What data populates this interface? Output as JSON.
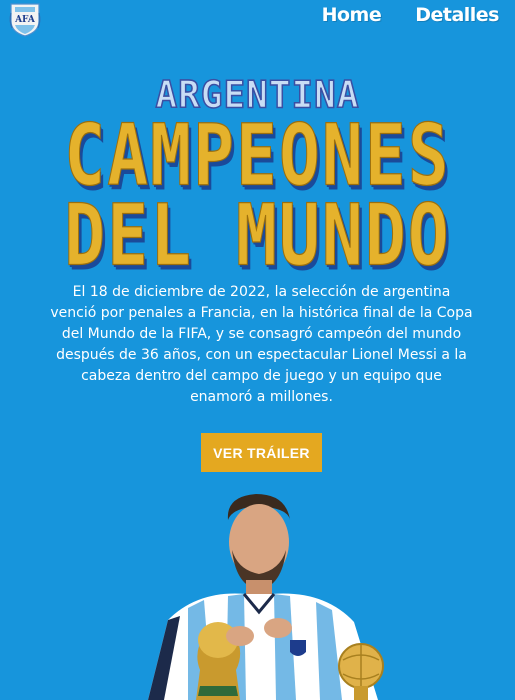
{
  "header": {
    "logo_text": "AFA",
    "nav": [
      {
        "label": "Home"
      },
      {
        "label": "Detalles"
      }
    ]
  },
  "hero_title": {
    "line1": "ARGENTINA",
    "line2": "CAMPEONES",
    "line3": "DEL MUNDO"
  },
  "description": "El 18 de diciembre de 2022, la selección de argentina venció por penales a Francia, en la histórica final de la Copa del Mundo de la FIFA, y se consagró campeón del mundo después de 36 años, con un espectacular Lionel Messi a la cabeza dentro del campo de juego y un equipo que enamoró a millones.",
  "cta": {
    "label": "VER TRÁILER"
  },
  "colors": {
    "background": "#1795dc",
    "gold": "#e5b22c",
    "button": "#e4a820",
    "title_light": "#c8ddf5"
  },
  "icons": {
    "logo": "afa-crest-icon",
    "hero": "messi-with-trophy-image"
  }
}
